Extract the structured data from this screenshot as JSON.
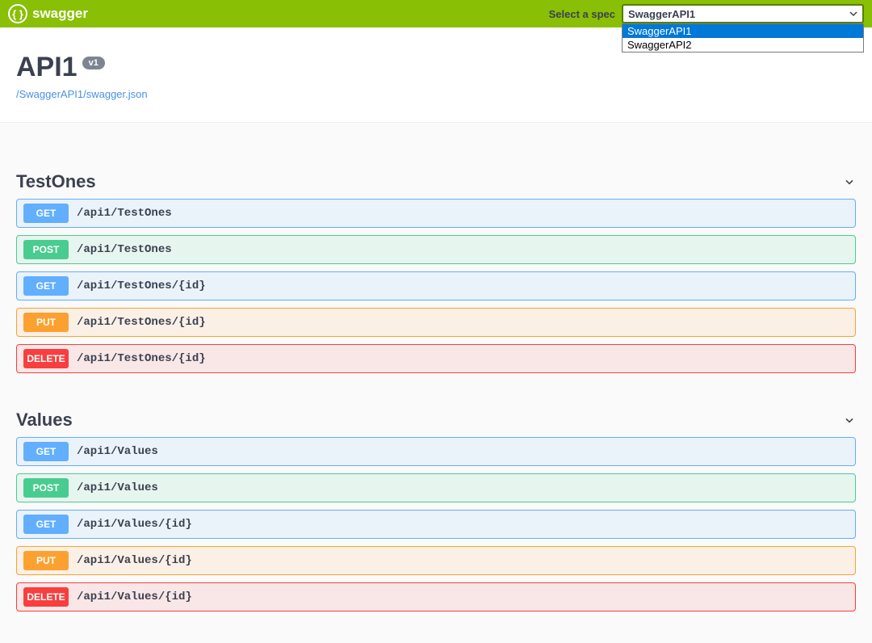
{
  "topbar": {
    "brand": "swagger",
    "select_label": "Select a spec",
    "selected": "SwaggerAPI1",
    "options": [
      "SwaggerAPI1",
      "SwaggerAPI2"
    ]
  },
  "info": {
    "title": "API1",
    "version": "v1",
    "spec_url": "/SwaggerAPI1/swagger.json"
  },
  "tags": [
    {
      "name": "TestOnes",
      "ops": [
        {
          "method": "GET",
          "path": "/api1/TestOnes"
        },
        {
          "method": "POST",
          "path": "/api1/TestOnes"
        },
        {
          "method": "GET",
          "path": "/api1/TestOnes/{id}"
        },
        {
          "method": "PUT",
          "path": "/api1/TestOnes/{id}"
        },
        {
          "method": "DELETE",
          "path": "/api1/TestOnes/{id}"
        }
      ]
    },
    {
      "name": "Values",
      "ops": [
        {
          "method": "GET",
          "path": "/api1/Values"
        },
        {
          "method": "POST",
          "path": "/api1/Values"
        },
        {
          "method": "GET",
          "path": "/api1/Values/{id}"
        },
        {
          "method": "PUT",
          "path": "/api1/Values/{id}"
        },
        {
          "method": "DELETE",
          "path": "/api1/Values/{id}"
        }
      ]
    }
  ]
}
